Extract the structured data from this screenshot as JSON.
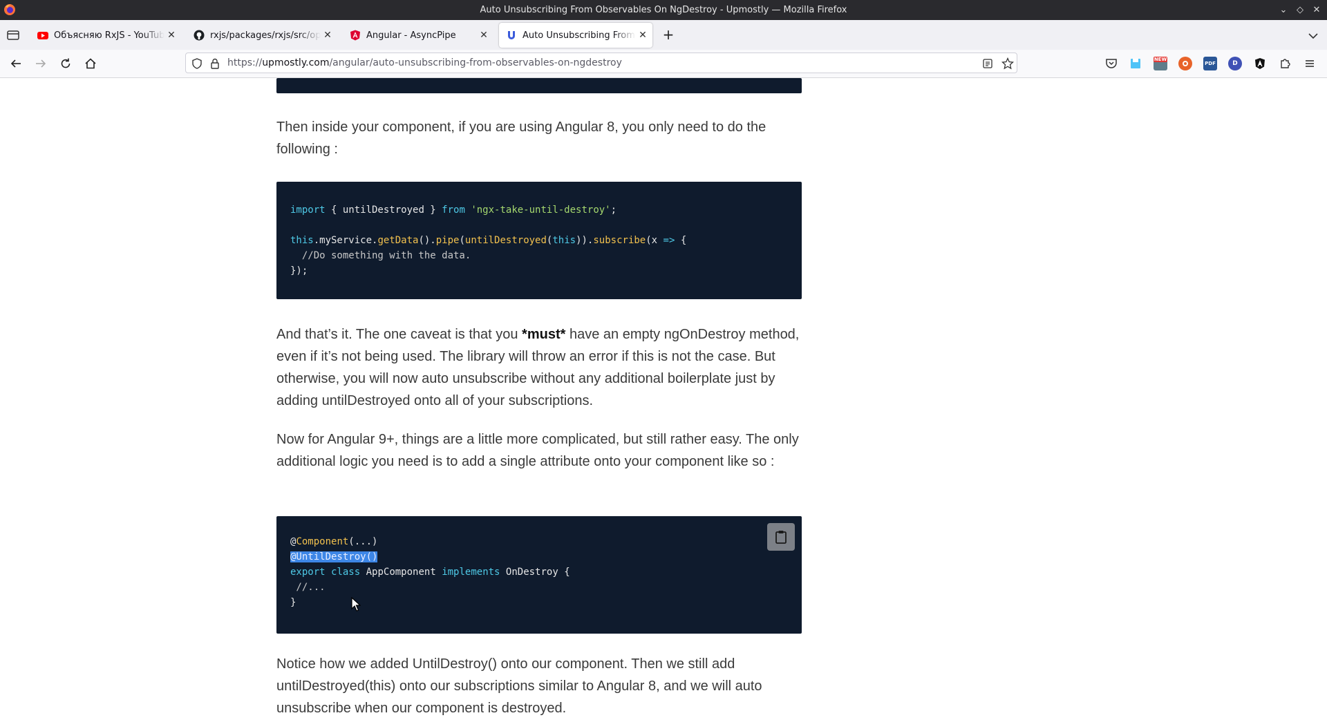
{
  "window": {
    "title": "Auto Unsubscribing From Observables On NgDestroy - Upmostly — Mozilla Firefox"
  },
  "tabs": [
    {
      "label": "Объясняю RxJS - YouTube",
      "favicon": "youtube-icon",
      "active": false
    },
    {
      "label": "rxjs/packages/rxjs/src/operators",
      "favicon": "github-icon",
      "active": false
    },
    {
      "label": "Angular - AsyncPipe",
      "favicon": "angular-icon",
      "active": false
    },
    {
      "label": "Auto Unsubscribing From Observables",
      "favicon": "upmostly-icon",
      "active": true
    }
  ],
  "address_bar": {
    "prefix": "https://",
    "domain": "upmostly.com",
    "path": "/angular/auto-unsubscribing-from-observables-on-ngdestroy"
  },
  "toolbar_extensions": [
    "pocket-icon",
    "bookmark-save-icon",
    "new-badge-icon",
    "duckduckgo-icon",
    "pdf-icon",
    "d-extension-icon",
    "angular-devtools-icon",
    "extensions-puzzle-icon",
    "menu-icon"
  ],
  "toolbar_extension_labels": {
    "new_badge": "NEW",
    "pdf": "PDF",
    "d_extension": "D"
  },
  "article": {
    "p1": "Then inside your component, if you are using Angular 8, you only need to do the following :",
    "code1": {
      "import_kw": "import",
      "import_mid": " { untilDestroyed } ",
      "from_kw": "from",
      "import_str": "'ngx-take-until-destroy'",
      "import_end": ";",
      "this1": "this",
      "service": ".myService.",
      "getData": "getData",
      "paren1": "().",
      "pipe": "pipe",
      "paren2": "(",
      "untilDestroyed": "untilDestroyed",
      "paren3": "(",
      "this2": "this",
      "paren4": ")).",
      "subscribe": "subscribe",
      "paren5": "(x ",
      "arrow": "=>",
      "brace": " {",
      "comment": "  //Do something with the data.",
      "close": "});"
    },
    "p2_pre": "And that’s it. The one caveat is that you ",
    "p2_bold": "*must*",
    "p2_post": " have an empty ngOnDestroy method, even if it’s not being used. The library will throw an error if this is not the case. But otherwise, you will now auto unsubscribe without any additional boilerplate just by adding untilDestroyed onto all of your subscriptions.",
    "p3": "Now for Angular 9+, things are a little more complicated, but still rather easy. The only additional logic you need is to add a single attribute onto your component like so :",
    "code2": {
      "at1": "@",
      "component": "Component",
      "comp_args": "(...)",
      "selected": "@UntilDestroy()",
      "export_kw": "export",
      "class_kw": "class",
      "classname": " AppComponent ",
      "implements_kw": "implements",
      "iface": " OnDestroy {",
      "comment": " //...",
      "close": "}"
    },
    "p4": "Notice how we added UntilDestroy() onto our component. Then we still add untilDestroyed(this) onto our subscriptions similar to Angular 8, and we will auto unsubscribe when our component is destroyed."
  }
}
